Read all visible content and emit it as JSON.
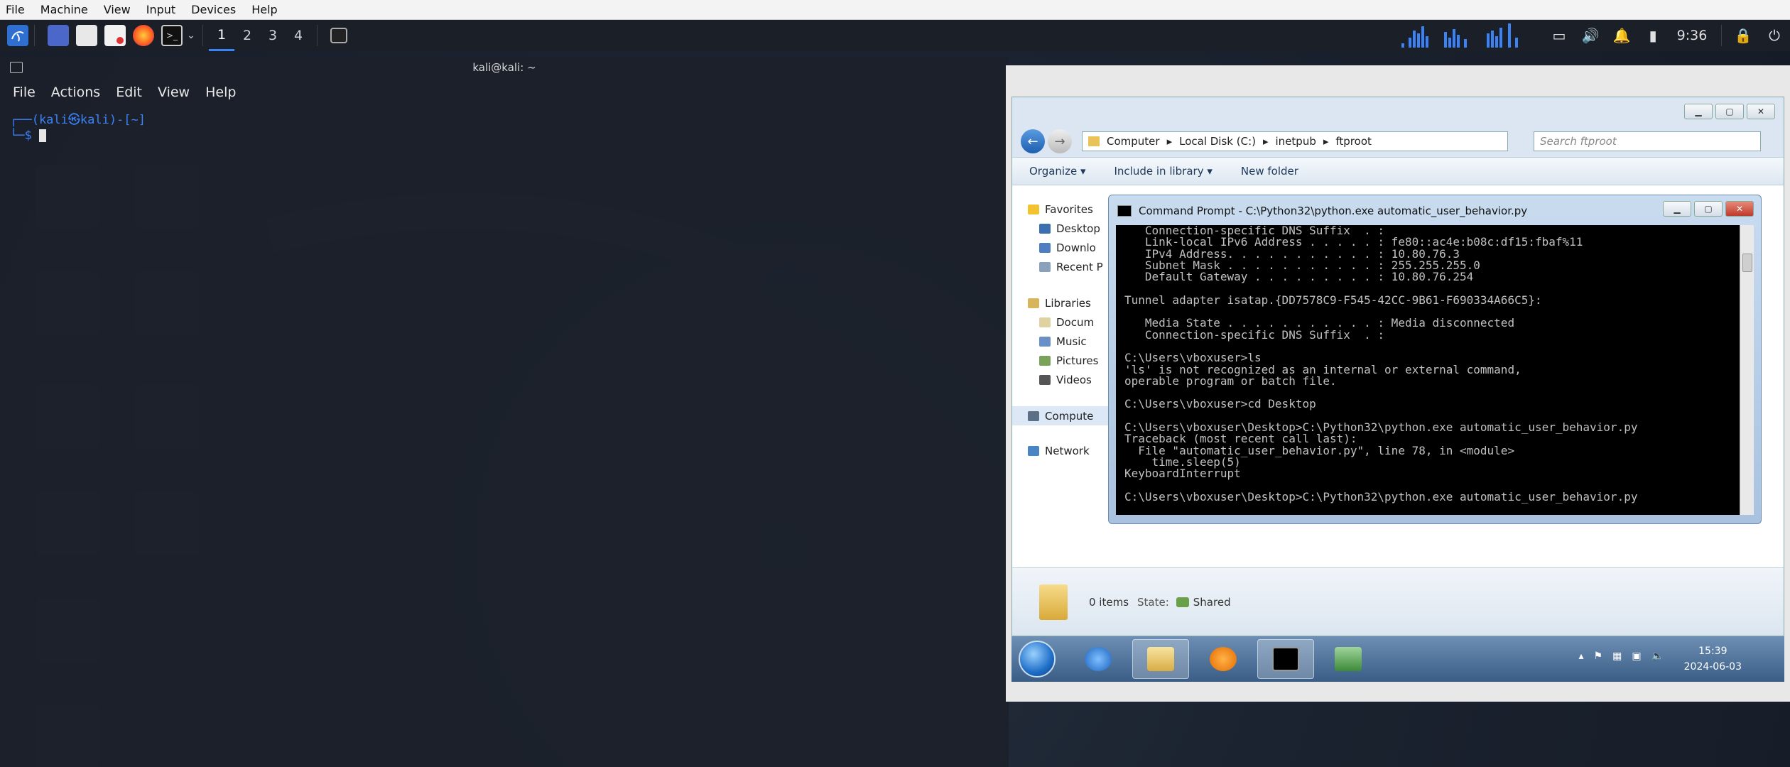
{
  "vbox_menu": [
    "File",
    "Machine",
    "View",
    "Input",
    "Devices",
    "Help"
  ],
  "kali_panel": {
    "workspaces": [
      "1",
      "2",
      "3",
      "4"
    ],
    "active_workspace": "1",
    "clock": "9:36",
    "icons": [
      "kali-menu-icon",
      "desktop-icon",
      "files-icon",
      "text-editor-icon",
      "firefox-icon",
      "terminal-icon"
    ]
  },
  "terminal": {
    "title": "kali@kali: ~",
    "menu": [
      "File",
      "Actions",
      "Edit",
      "View",
      "Help"
    ],
    "prompt_line1": "┌──(kali㉿kali)-[~]",
    "prompt_line2": "└─$ "
  },
  "explorer": {
    "breadcrumb": [
      "Computer",
      "Local Disk (C:)",
      "inetpub",
      "ftproot"
    ],
    "search_placeholder": "Search ftproot",
    "toolbar": {
      "organize": "Organize ▾",
      "include": "Include in library ▾",
      "new_folder": "New folder"
    },
    "nav": {
      "favorites": "Favorites",
      "favorites_items": [
        "Desktop",
        "Downlo",
        "Recent P"
      ],
      "libraries": "Libraries",
      "libraries_items": [
        "Docum",
        "Music",
        "Pictures",
        "Videos"
      ],
      "computer": "Compute",
      "network": "Network"
    },
    "status": {
      "items": "0 items",
      "state_label": "State:",
      "state_value": "Shared"
    }
  },
  "cmd": {
    "title": "Command Prompt - C:\\Python32\\python.exe  automatic_user_behavior.py",
    "lines": [
      "   Connection-specific DNS Suffix  . :",
      "   Link-local IPv6 Address . . . . . : fe80::ac4e:b08c:df15:fbaf%11",
      "   IPv4 Address. . . . . . . . . . . : 10.80.76.3",
      "   Subnet Mask . . . . . . . . . . . : 255.255.255.0",
      "   Default Gateway . . . . . . . . . : 10.80.76.254",
      "",
      "Tunnel adapter isatap.{DD7578C9-F545-42CC-9B61-F690334A66C5}:",
      "",
      "   Media State . . . . . . . . . . . : Media disconnected",
      "   Connection-specific DNS Suffix  . :",
      "",
      "C:\\Users\\vboxuser>ls",
      "'ls' is not recognized as an internal or external command,",
      "operable program or batch file.",
      "",
      "C:\\Users\\vboxuser>cd Desktop",
      "",
      "C:\\Users\\vboxuser\\Desktop>C:\\Python32\\python.exe automatic_user_behavior.py",
      "Traceback (most recent call last):",
      "  File \"automatic_user_behavior.py\", line 78, in <module>",
      "    time.sleep(5)",
      "KeyboardInterrupt",
      "",
      "C:\\Users\\vboxuser\\Desktop>C:\\Python32\\python.exe automatic_user_behavior.py"
    ]
  },
  "win_taskbar": {
    "time": "15:39",
    "date": "2024-06-03"
  },
  "colors": {
    "kali_blue": "#3b82f6",
    "win7_taskbar": "#3a5d86"
  }
}
